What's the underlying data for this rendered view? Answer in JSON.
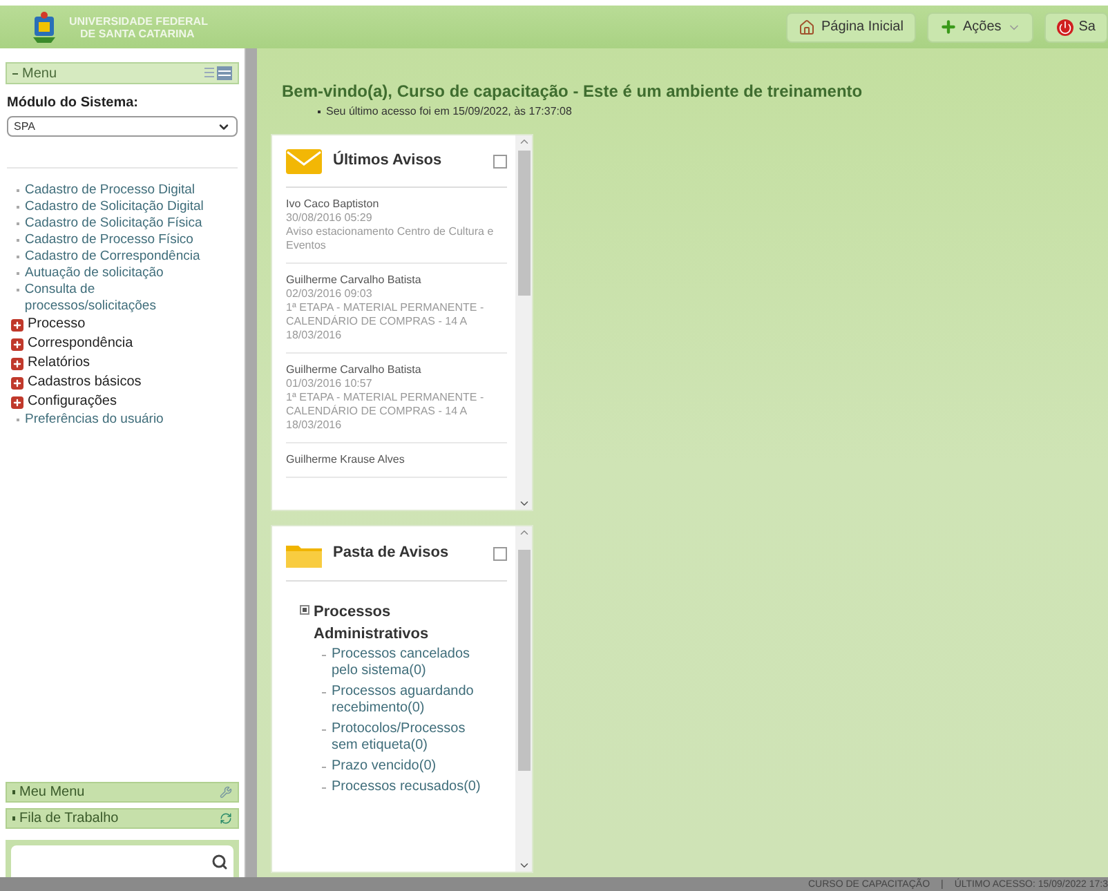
{
  "header": {
    "logo_lines": [
      "UNIVERSIDADE FEDERAL",
      "DE SANTA CATARINA"
    ],
    "buttons": [
      {
        "label": "Página Inicial",
        "kind": "home"
      },
      {
        "label": "Ações",
        "kind": "dropdown"
      },
      {
        "label": "Sa",
        "kind": "power"
      }
    ]
  },
  "sidebar": {
    "title": "Menu",
    "module_label": "Módulo do Sistema:",
    "module_value": "SPA",
    "items": [
      {
        "label": "Cadastro de Processo Digital",
        "kind": "link"
      },
      {
        "label": "Cadastro de Solicitação Digital",
        "kind": "link"
      },
      {
        "label": "Cadastro de Solicitação Física",
        "kind": "link"
      },
      {
        "label": "Cadastro de Processo Físico",
        "kind": "link"
      },
      {
        "label": "Cadastro de Correspondência",
        "kind": "link"
      },
      {
        "label": "Autuação de solicitação",
        "kind": "link"
      },
      {
        "label": "Consulta de processos/solicitações",
        "kind": "link"
      },
      {
        "label": "Processo",
        "kind": "group"
      },
      {
        "label": "Correspondência",
        "kind": "group"
      },
      {
        "label": "Relatórios",
        "kind": "group"
      },
      {
        "label": "Cadastros básicos",
        "kind": "group"
      },
      {
        "label": "Configurações",
        "kind": "group"
      },
      {
        "label": "Preferências do usuário",
        "kind": "link"
      }
    ],
    "bottom_panels": [
      {
        "label": "Meu Menu",
        "kind": "tools"
      },
      {
        "label": "Fila de Trabalho",
        "kind": "sync"
      }
    ]
  },
  "welcome": {
    "title": "Bem-vindo(a), Curso de capacitação - Este é um ambiente de treinamento",
    "last_access": "Seu último acesso foi em 15/09/2022, às 17:37:08"
  },
  "notices": {
    "title": "Últimos Avisos",
    "items": [
      {
        "author": "Ivo Caco Baptiston",
        "date": "30/08/2016 05:29",
        "text": "Aviso estacionamento Centro de Cultura e Eventos"
      },
      {
        "author": "Guilherme Carvalho Batista",
        "date": "02/03/2016 09:03",
        "text": "1ª ETAPA - MATERIAL PERMANENTE - CALENDÁRIO DE COMPRAS - 14 A 18/03/2016"
      },
      {
        "author": "Guilherme Carvalho Batista",
        "date": "01/03/2016 10:57",
        "text": "1ª ETAPA - MATERIAL PERMANENTE - CALENDÁRIO DE COMPRAS - 14 A 18/03/2016"
      },
      {
        "author": "Guilherme Krause Alves"
      }
    ]
  },
  "folder": {
    "title": "Pasta de Avisos",
    "group": "Processos Administrativos",
    "expanded": true,
    "items": [
      "Processos cancelados pelo sistema(0)",
      "Processos aguardando recebimento(0)",
      "Protocolos/Processos sem etiqueta(0)",
      "Prazo vencido(0)",
      "Processos recusados(0)"
    ]
  },
  "status_bar": [
    "CURSO DE CAPACITAÇÃO",
    "|",
    "ÚLTIMO ACESSO: 15/09/2022 17:3"
  ]
}
